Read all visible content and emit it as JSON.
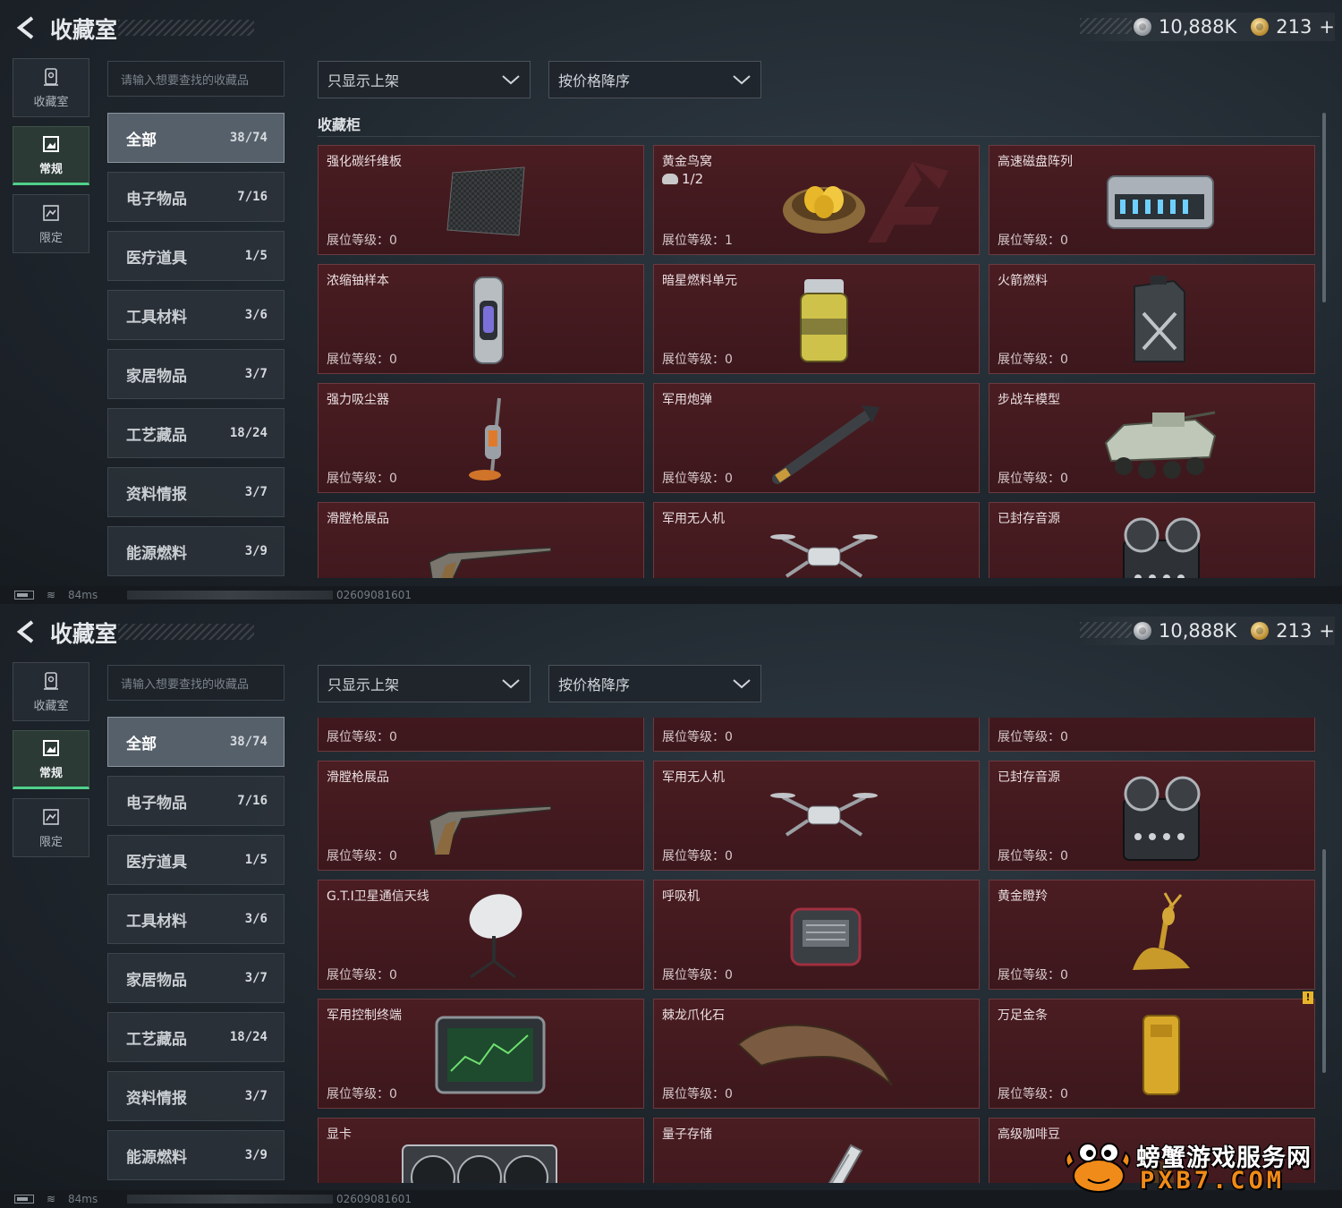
{
  "app": {
    "title": "收藏室"
  },
  "currency": {
    "silver": "10,888K",
    "gold": "213",
    "add": "+"
  },
  "left_tabs": [
    {
      "label": "收藏室",
      "icon": "vault-icon"
    },
    {
      "label": "常规",
      "icon": "frame-icon",
      "active": true
    },
    {
      "label": "限定",
      "icon": "limited-icon"
    }
  ],
  "search": {
    "placeholder": "请输入想要查找的收藏品"
  },
  "categories": [
    {
      "name": "全部",
      "count": "38/74",
      "active": true
    },
    {
      "name": "电子物品",
      "count": "7/16"
    },
    {
      "name": "医疗道具",
      "count": "1/5"
    },
    {
      "name": "工具材料",
      "count": "3/6"
    },
    {
      "name": "家居物品",
      "count": "3/7"
    },
    {
      "name": "工艺藏品",
      "count": "18/24"
    },
    {
      "name": "资料情报",
      "count": "3/7"
    },
    {
      "name": "能源燃料",
      "count": "3/9"
    }
  ],
  "filters": {
    "show": "只显示上架",
    "sort": "按价格降序"
  },
  "section_title": "收藏柜",
  "level_label": "展位等级：",
  "items_top": [
    {
      "name": "强化碳纤维板",
      "level": "0",
      "icon": "carbon-plate-icon"
    },
    {
      "name": "黄金鸟窝",
      "level": "1",
      "extra": "1/2",
      "icon": "golden-nest-icon"
    },
    {
      "name": "高速磁盘阵列",
      "level": "0",
      "icon": "disk-array-icon"
    },
    {
      "name": "浓缩铀样本",
      "level": "0",
      "icon": "uranium-canister-icon"
    },
    {
      "name": "暗星燃料单元",
      "level": "0",
      "icon": "fuel-cell-icon"
    },
    {
      "name": "火箭燃料",
      "level": "0",
      "icon": "jerrycan-icon"
    },
    {
      "name": "强力吸尘器",
      "level": "0",
      "icon": "vacuum-cleaner-icon"
    },
    {
      "name": "军用炮弹",
      "level": "0",
      "icon": "missile-icon"
    },
    {
      "name": "步战车模型",
      "level": "0",
      "icon": "ifv-model-icon"
    },
    {
      "name": "滑膛枪展品",
      "level": "",
      "icon": "musket-icon"
    },
    {
      "name": "军用无人机",
      "level": "",
      "icon": "drone-icon"
    },
    {
      "name": "已封存音源",
      "level": "",
      "icon": "reel-recorder-icon"
    }
  ],
  "items_bottom": [
    {
      "name": "",
      "level": "0",
      "icon": "vacuum-cleaner-icon"
    },
    {
      "name": "",
      "level": "0",
      "icon": "missile-icon"
    },
    {
      "name": "",
      "level": "0",
      "icon": "ifv-model-icon"
    },
    {
      "name": "滑膛枪展品",
      "level": "0",
      "icon": "musket-icon"
    },
    {
      "name": "军用无人机",
      "level": "0",
      "icon": "drone-icon"
    },
    {
      "name": "已封存音源",
      "level": "0",
      "icon": "reel-recorder-icon"
    },
    {
      "name": "G.T.I卫星通信天线",
      "level": "0",
      "icon": "satellite-dish-icon"
    },
    {
      "name": "呼吸机",
      "level": "0",
      "icon": "ventilator-icon"
    },
    {
      "name": "黄金瞪羚",
      "level": "0",
      "icon": "golden-gazelle-icon"
    },
    {
      "name": "军用控制终端",
      "level": "0",
      "icon": "control-terminal-icon"
    },
    {
      "name": "棘龙爪化石",
      "level": "0",
      "icon": "claw-fossil-icon"
    },
    {
      "name": "万足金条",
      "level": "0",
      "icon": "gold-bar-icon"
    },
    {
      "name": "显卡",
      "level": "",
      "icon": "graphics-card-icon"
    },
    {
      "name": "量子存储",
      "level": "",
      "icon": "quantum-storage-icon"
    },
    {
      "name": "高级咖啡豆",
      "level": "",
      "icon": "coffee-beans-icon"
    }
  ],
  "status": {
    "ping": "84ms",
    "uid": "02609081601",
    "wifi": "wifi-icon",
    "battery": "battery-icon"
  },
  "warning_badge": "!",
  "brand": {
    "line1": "螃蟹游戏服务网",
    "line2": "PXB7.COM",
    "icon": "crab-mascot-icon"
  },
  "colors": {
    "card_bg": "#4a1d22",
    "accent_green": "#4fd08a",
    "brand_orange": "#f08a18"
  }
}
